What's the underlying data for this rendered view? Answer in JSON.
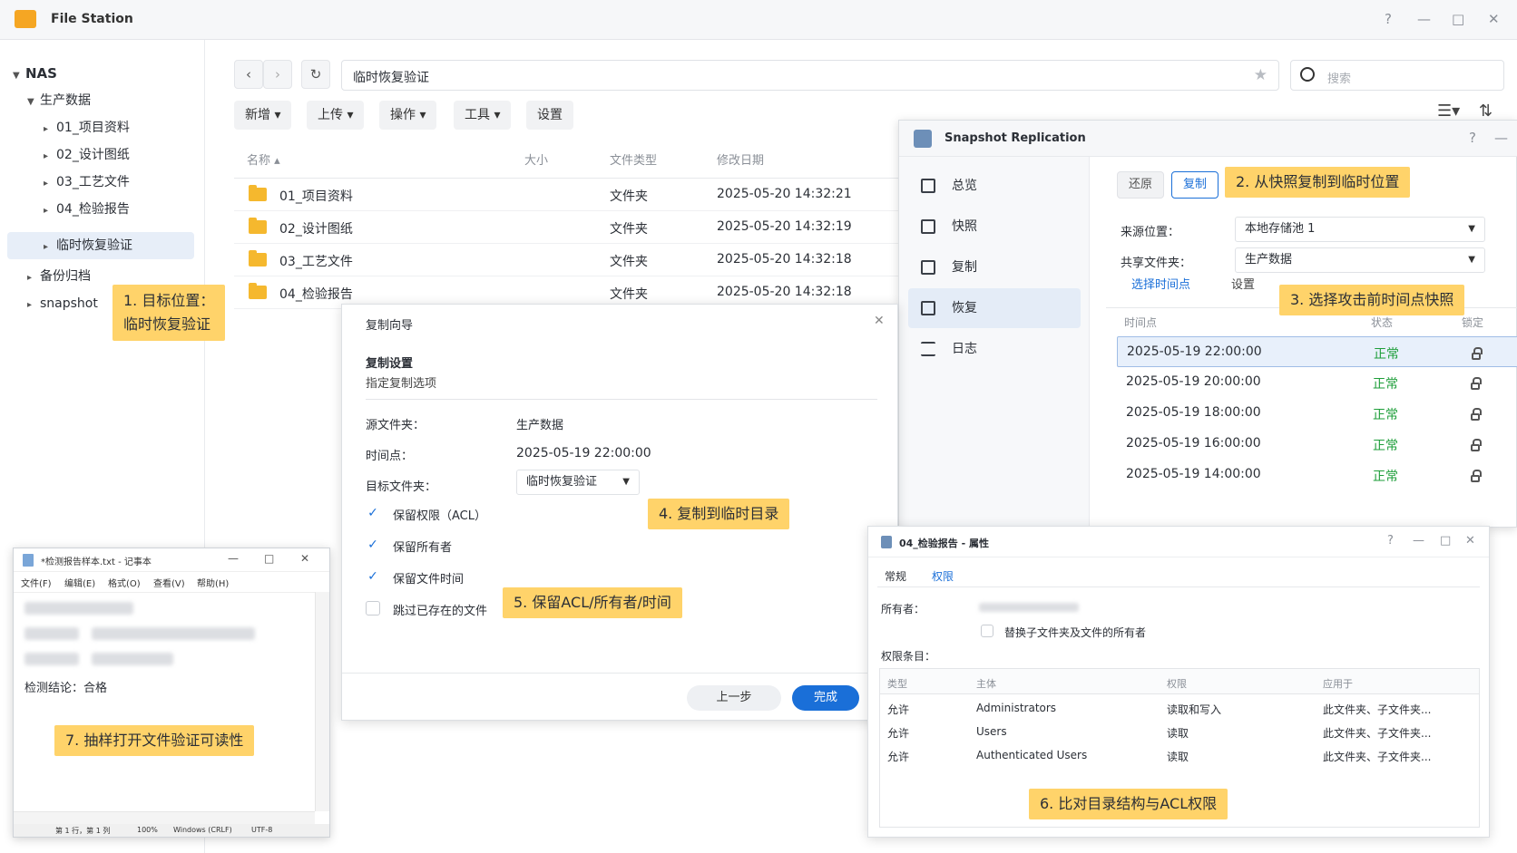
{
  "file_station": {
    "title": "File Station",
    "sidebar": {
      "root": "NAS",
      "items": [
        {
          "label": "生产数据"
        },
        {
          "label": "01_项目资料"
        },
        {
          "label": "02_设计图纸"
        },
        {
          "label": "03_工艺文件"
        },
        {
          "label": "04_检验报告"
        },
        {
          "label": "临时恢复验证"
        },
        {
          "label": "备份归档"
        },
        {
          "label": "snapshot"
        }
      ]
    },
    "path": "临时恢复验证",
    "search_placeholder": "搜索",
    "toolbar": {
      "new": "新增",
      "upload": "上传",
      "action": "操作",
      "tools": "工具",
      "settings": "设置"
    },
    "columns": {
      "name": "名称",
      "size": "大小",
      "type": "文件类型",
      "modified": "修改日期"
    },
    "files": [
      {
        "name": "01_项目资料",
        "type": "文件夹",
        "modified": "2025-05-20 14:32:21"
      },
      {
        "name": "02_设计图纸",
        "type": "文件夹",
        "modified": "2025-05-20 14:32:19"
      },
      {
        "name": "03_工艺文件",
        "type": "文件夹",
        "modified": "2025-05-20 14:32:18"
      },
      {
        "name": "04_检验报告",
        "type": "文件夹",
        "modified": "2025-05-20 14:32:18"
      }
    ]
  },
  "callouts": {
    "c1_line1": "1. 目标位置：",
    "c1_line2": "临时恢复验证",
    "c2": "2. 从快照复制到临时位置",
    "c3": "3. 选择攻击前时间点快照",
    "c4": "4. 复制到临时目录",
    "c5": "5. 保留ACL/所有者/时间",
    "c6": "6. 比对目录结构与ACL权限",
    "c7": "7. 抽样打开文件验证可读性"
  },
  "snapshot_replication": {
    "title": "Snapshot Replication",
    "nav": {
      "overview": "总览",
      "snapshot": "快照",
      "replication": "复制",
      "restore": "恢复",
      "log": "日志"
    },
    "tabs": {
      "restore": "还原",
      "copy": "复制"
    },
    "source_label": "来源位置：",
    "source_value": "本地存储池 1",
    "share_label": "共享文件夹：",
    "share_value": "生产数据",
    "subtabs": {
      "timepoint": "选择时间点",
      "settings": "设置"
    },
    "table_head": {
      "time": "时间点",
      "status": "状态",
      "lock": "锁定"
    },
    "snapshots": [
      {
        "time": "2025-05-19 22:00:00",
        "status": "正常"
      },
      {
        "time": "2025-05-19 20:00:00",
        "status": "正常"
      },
      {
        "time": "2025-05-19 18:00:00",
        "status": "正常"
      },
      {
        "time": "2025-05-19 16:00:00",
        "status": "正常"
      },
      {
        "time": "2025-05-19 14:00:00",
        "status": "正常"
      }
    ],
    "status_color": "#1e9e3a"
  },
  "wizard": {
    "title": "复制向导",
    "section": "复制设置",
    "subtitle": "指定复制选项",
    "source_label": "源文件夹：",
    "source_value": "生产数据",
    "time_label": "时间点：",
    "time_value": "2025-05-19 22:00:00",
    "target_label": "目标文件夹：",
    "target_value": "临时恢复验证",
    "options": [
      {
        "label": "保留权限（ACL）",
        "checked": true
      },
      {
        "label": "保留所有者",
        "checked": true
      },
      {
        "label": "保留文件时间",
        "checked": true
      },
      {
        "label": "跳过已存在的文件",
        "checked": false
      }
    ],
    "back": "上一步",
    "finish": "完成",
    "accent": "#1a6fd8"
  },
  "notepad": {
    "title": "*检测报告样本.txt - 记事本",
    "menu": [
      "文件(F)",
      "编辑(E)",
      "格式(O)",
      "查看(V)",
      "帮助(H)"
    ],
    "conclusion": "检测结论：合格",
    "status": {
      "pos": "第 1 行，第 1 列",
      "zoom": "100%",
      "eol": "Windows (CRLF)",
      "enc": "UTF-8"
    }
  },
  "properties": {
    "title": "04_检验报告 - 属性",
    "tabs": {
      "general": "常规",
      "permissions": "权限"
    },
    "owner_label": "所有者：",
    "replace_owner": "替换子文件夹及文件的所有者",
    "entries_label": "权限条目：",
    "head": {
      "type": "类型",
      "principal": "主体",
      "perm": "权限",
      "apply": "应用于"
    },
    "rows": [
      {
        "type": "允许",
        "principal": "Administrators",
        "perm": "读取和写入",
        "apply": "此文件夹、子文件夹..."
      },
      {
        "type": "允许",
        "principal": "Users",
        "perm": "读取",
        "apply": "此文件夹、子文件夹..."
      },
      {
        "type": "允许",
        "principal": "Authenticated Users",
        "perm": "读取",
        "apply": "此文件夹、子文件夹..."
      }
    ]
  }
}
